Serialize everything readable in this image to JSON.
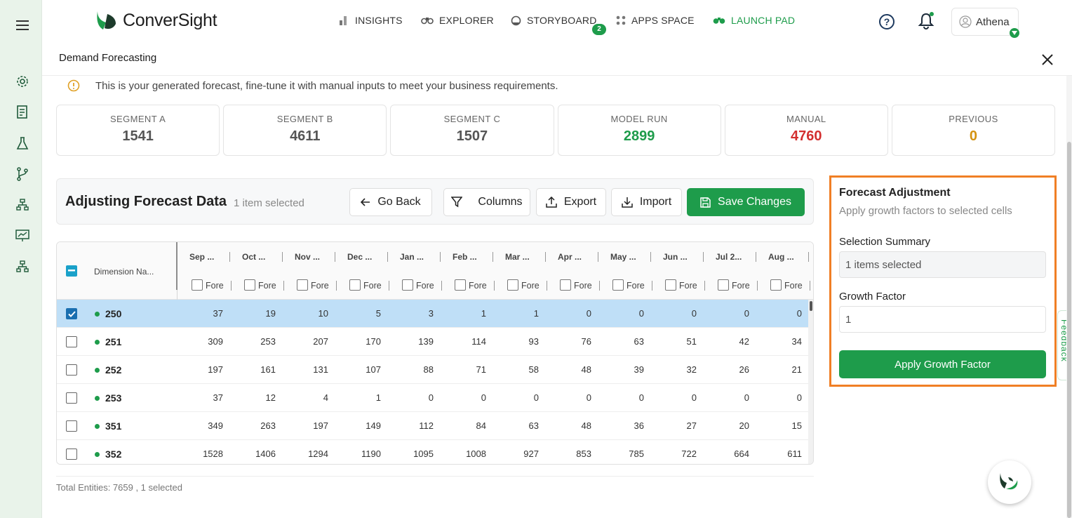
{
  "app": {
    "name": "ConverSight",
    "page_title": "Demand Forecasting"
  },
  "nav": [
    {
      "label": "INSIGHTS",
      "icon": "bar-chart-icon",
      "active": false
    },
    {
      "label": "EXPLORER",
      "icon": "binoculars-icon",
      "active": false
    },
    {
      "label": "STORYBOARD",
      "icon": "storyboard-icon",
      "active": false,
      "badge": "2"
    },
    {
      "label": "APPS SPACE",
      "icon": "apps-grid-icon",
      "active": false
    },
    {
      "label": "LAUNCH PAD",
      "icon": "launch-pad-icon",
      "active": true
    }
  ],
  "user": {
    "name": "Athena"
  },
  "sidebar_icons": [
    "settings-icon",
    "report-icon",
    "flask-icon",
    "branch-icon",
    "hierarchy-icon",
    "presentation-icon",
    "org-chart-icon"
  ],
  "info_message": "This is your generated forecast, fine-tune it with manual inputs to meet your business requirements.",
  "kpis": [
    {
      "label": "SEGMENT A",
      "value": "1541",
      "color": "#555555"
    },
    {
      "label": "SEGMENT B",
      "value": "4611",
      "color": "#555555"
    },
    {
      "label": "SEGMENT C",
      "value": "1507",
      "color": "#555555"
    },
    {
      "label": "MODEL RUN",
      "value": "2899",
      "color": "#1e9c4b"
    },
    {
      "label": "MANUAL",
      "value": "4760",
      "color": "#d32f2f"
    },
    {
      "label": "PREVIOUS",
      "value": "0",
      "color": "#d4920f"
    }
  ],
  "toolbar": {
    "title": "Adjusting Forecast Data",
    "selection": "1 item selected",
    "go_back": "Go Back",
    "columns": "Columns",
    "export": "Export",
    "import": "Import",
    "save": "Save Changes"
  },
  "table": {
    "dimension_header": "Dimension Na...",
    "columns": [
      "Sep ...",
      "Oct ...",
      "Nov ...",
      "Dec ...",
      "Jan ...",
      "Feb ...",
      "Mar ...",
      "Apr ...",
      "May ...",
      "Jun ...",
      "Jul 2...",
      "Aug ..."
    ],
    "sub_label": "Fore",
    "rows": [
      {
        "id": "250",
        "selected": true,
        "values": [
          "37",
          "19",
          "10",
          "5",
          "3",
          "1",
          "1",
          "0",
          "0",
          "0",
          "0",
          "0"
        ]
      },
      {
        "id": "251",
        "selected": false,
        "values": [
          "309",
          "253",
          "207",
          "170",
          "139",
          "114",
          "93",
          "76",
          "63",
          "51",
          "42",
          "34"
        ]
      },
      {
        "id": "252",
        "selected": false,
        "values": [
          "197",
          "161",
          "131",
          "107",
          "88",
          "71",
          "58",
          "48",
          "39",
          "32",
          "26",
          "21"
        ]
      },
      {
        "id": "253",
        "selected": false,
        "values": [
          "37",
          "12",
          "4",
          "1",
          "0",
          "0",
          "0",
          "0",
          "0",
          "0",
          "0",
          "0"
        ]
      },
      {
        "id": "351",
        "selected": false,
        "values": [
          "349",
          "263",
          "197",
          "149",
          "112",
          "84",
          "63",
          "48",
          "36",
          "27",
          "20",
          "15"
        ]
      },
      {
        "id": "352",
        "selected": false,
        "values": [
          "1528",
          "1406",
          "1294",
          "1190",
          "1095",
          "1008",
          "927",
          "853",
          "785",
          "722",
          "664",
          "611"
        ]
      }
    ],
    "footer": "Total Entities: 7659 , 1 selected"
  },
  "panel": {
    "title": "Forecast Adjustment",
    "subtitle": "Apply growth factors to selected cells",
    "summary_label": "Selection Summary",
    "summary_value": "1 items selected",
    "growth_label": "Growth Factor",
    "growth_value": "1",
    "apply_label": "Apply Growth Factor"
  },
  "feedback_label": "Feedback"
}
